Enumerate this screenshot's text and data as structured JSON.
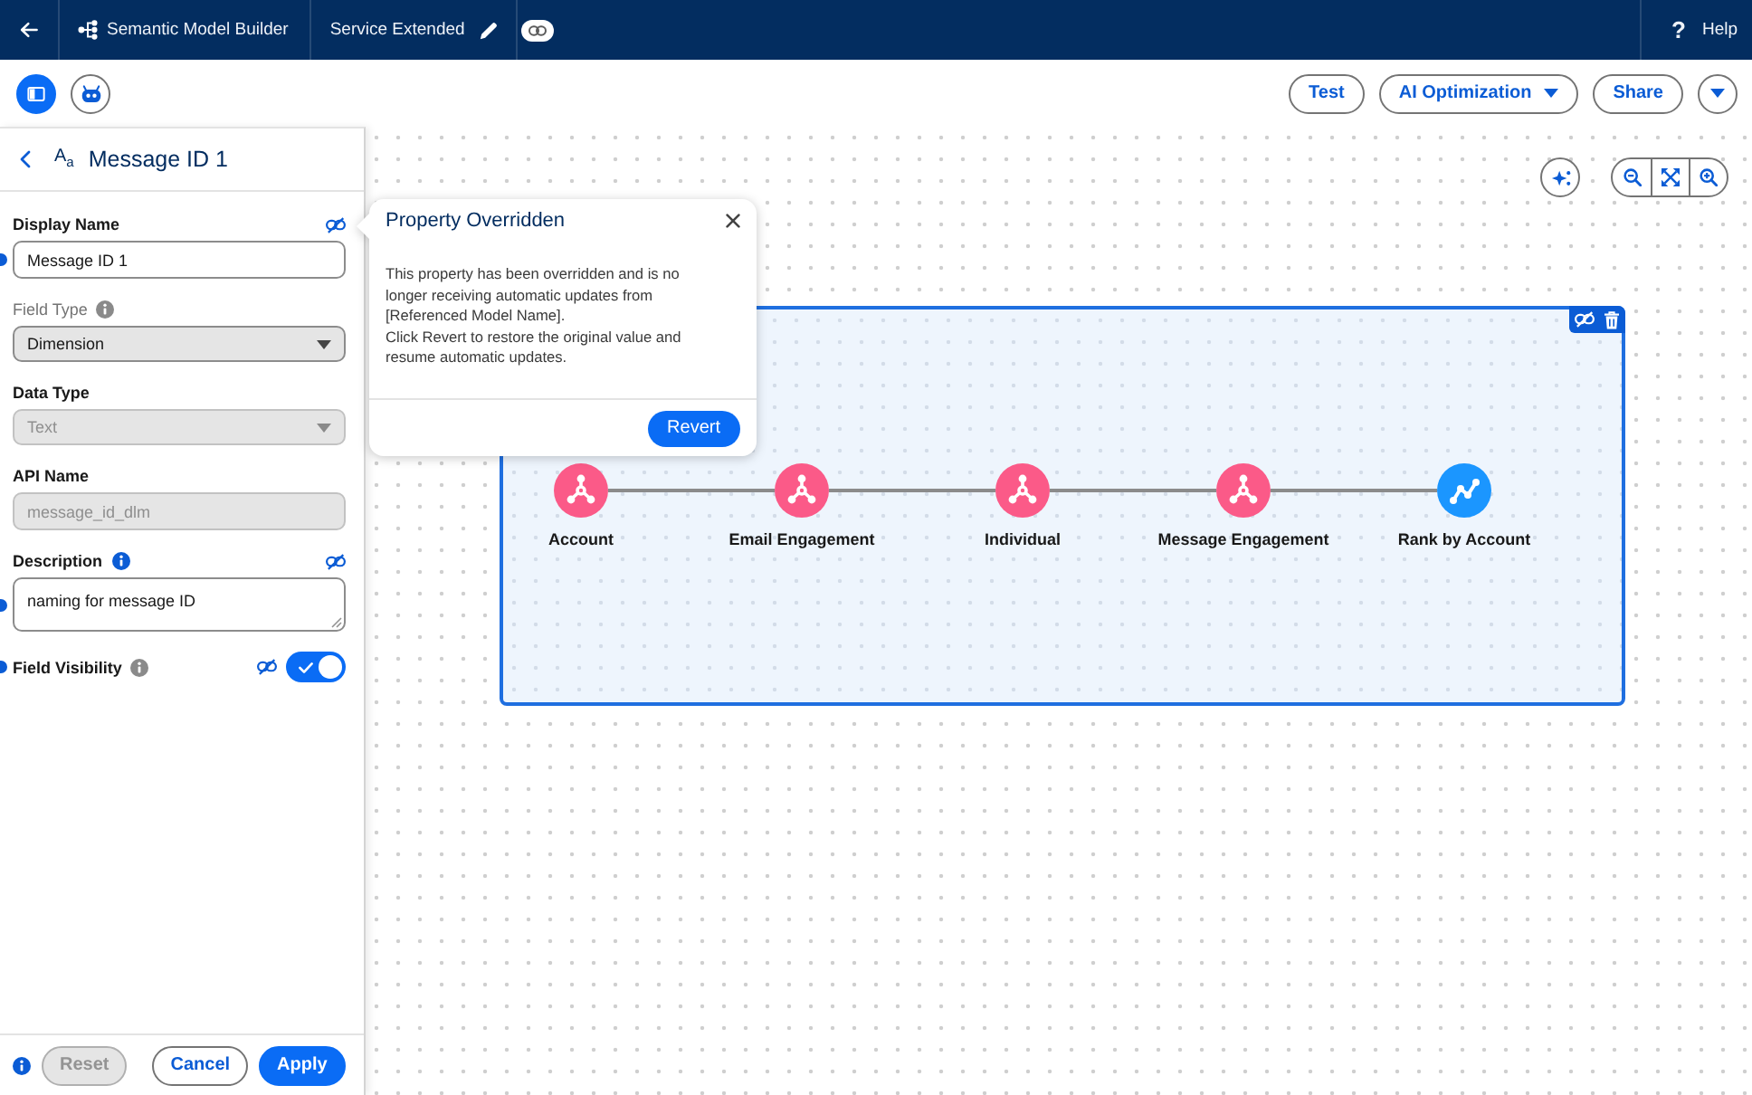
{
  "header": {
    "app": "Semantic Model Builder",
    "model": "Service Extended",
    "help_glyph": "?",
    "help": "Help"
  },
  "toolbar": {
    "tools": [
      {
        "kind": "panel",
        "selected": true
      },
      {
        "kind": "agent",
        "selected": false
      }
    ],
    "actions": [
      {
        "kind": "button",
        "label": "Test"
      },
      {
        "kind": "menu",
        "label": "AI Optimization"
      },
      {
        "kind": "button",
        "label": "Share"
      },
      {
        "kind": "more"
      }
    ]
  },
  "panel": {
    "type_glyph": "A$_{a}$",
    "title": "Message ID 1",
    "fields": [
      {
        "kind": "input",
        "label": "Display Name",
        "label_muted": false,
        "info": false,
        "overridden": true,
        "changed": true,
        "value": "Message ID 1",
        "disabled": false
      },
      {
        "kind": "select",
        "label": "Field Type",
        "label_muted": true,
        "info": true,
        "info_active": false,
        "overridden": false,
        "changed": false,
        "value": "Dimension",
        "disabled": false
      },
      {
        "kind": "select",
        "label": "Data Type",
        "label_muted": false,
        "info": false,
        "overridden": false,
        "changed": false,
        "value": "Text",
        "disabled": true
      },
      {
        "kind": "input",
        "label": "API Name",
        "label_muted": false,
        "info": false,
        "overridden": false,
        "changed": false,
        "value": "message_id_dlm",
        "disabled": true
      },
      {
        "kind": "textarea",
        "label": "Description",
        "label_muted": false,
        "info": true,
        "info_active": true,
        "overridden": true,
        "changed": true,
        "value": "naming for message ID",
        "disabled": false
      },
      {
        "kind": "toggle",
        "label": "Field Visibility",
        "label_muted": false,
        "info": true,
        "info_active": false,
        "overridden": true,
        "changed": true,
        "on": true
      }
    ],
    "footer_buttons": [
      {
        "kind": "neutral",
        "label": "Reset",
        "disabled": true
      },
      {
        "kind": "neutral",
        "label": "Cancel",
        "disabled": false
      },
      {
        "kind": "brand",
        "label": "Apply",
        "disabled": false
      }
    ]
  },
  "popover": {
    "title": "Property Overridden",
    "paragraphs": [
      "This property has been overridden and is no longer receiving automatic updates from [Referenced Model Name].",
      "Click Revert to restore the original value and resume automatic updates."
    ],
    "action": "Revert"
  },
  "canvas": {
    "nodes": [
      {
        "kind": "object",
        "label": "Account"
      },
      {
        "kind": "object",
        "label": "Email Engagement"
      },
      {
        "kind": "object",
        "label": "Individual"
      },
      {
        "kind": "object",
        "label": "Message Engagement"
      },
      {
        "kind": "metric",
        "label": "Rank by Account"
      }
    ]
  }
}
